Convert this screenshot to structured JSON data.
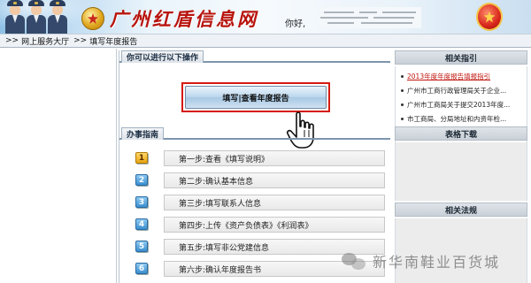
{
  "header": {
    "site_title": "广州红盾信息网",
    "greeting": "你好,"
  },
  "breadcrumb": {
    "separator": ">>",
    "items": [
      "网上服务大厅",
      "填写年度报告"
    ]
  },
  "main": {
    "ops_tab": "你可以进行以下操作",
    "fill_button": "填写|查看年度报告",
    "guide_tab": "办事指南",
    "steps": [
      {
        "num": "1",
        "label": "第一步:查看《填写说明》"
      },
      {
        "num": "2",
        "label": "第二步:确认基本信息"
      },
      {
        "num": "3",
        "label": "第三步:填写联系人信息"
      },
      {
        "num": "4",
        "label": "第四步:上传《资产负债表》《利润表》"
      },
      {
        "num": "5",
        "label": "第五步:填写非公党建信息"
      },
      {
        "num": "6",
        "label": "第六步:确认年度报告书"
      }
    ]
  },
  "sidebar": {
    "guide_title": "相关指引",
    "guide_links": [
      "2013年度年度报告填报指引",
      "广州市工商行政管理局关于企业...",
      "广州市工商局关于提交2013年度...",
      "市工商局、分局地址和内资年检..."
    ],
    "forms_title": "表格下载",
    "laws_title": "相关法规"
  },
  "watermark": {
    "text": "新华南鞋业百货城"
  },
  "colors": {
    "title_red": "#b8140e",
    "highlight_red": "#d41a12",
    "link_red": "#c0140c",
    "accent_blue": "#7d95ad"
  }
}
